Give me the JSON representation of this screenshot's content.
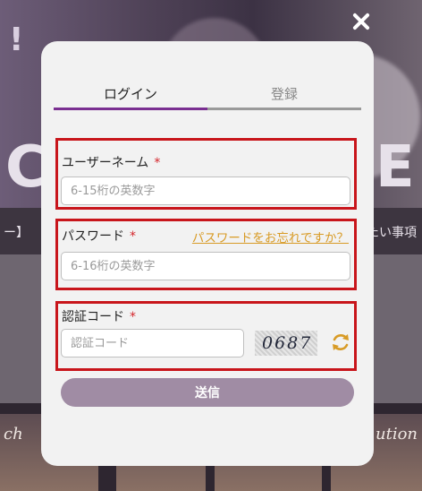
{
  "background": {
    "exclamation": "!",
    "big_left": "C",
    "big_right": "E",
    "strip_left": "ー】",
    "strip_right": "たい事項",
    "tile_left": "ch",
    "tile_right": "ution"
  },
  "modal": {
    "tabs": [
      {
        "label": "ログイン",
        "active": true
      },
      {
        "label": "登録",
        "active": false
      }
    ],
    "username": {
      "label": "ユーザーネーム",
      "required_mark": "*",
      "placeholder": "6-15桁の英数字"
    },
    "password": {
      "label": "パスワード",
      "required_mark": "*",
      "placeholder": "6-16桁の英数字",
      "forgot_link": "パスワードをお忘れですか？"
    },
    "captcha": {
      "label": "認証コード",
      "required_mark": "*",
      "placeholder": "認証コード",
      "image_text": "0687"
    },
    "submit_label": "送信"
  },
  "colors": {
    "tab_active": "#7a2f91",
    "highlight_border": "#c8151b",
    "forgot_link": "#d89b26",
    "submit_bg": "#a08ca4",
    "refresh_icon": "#d89b26"
  },
  "icons": {
    "close": "close-icon",
    "refresh": "refresh-icon"
  }
}
